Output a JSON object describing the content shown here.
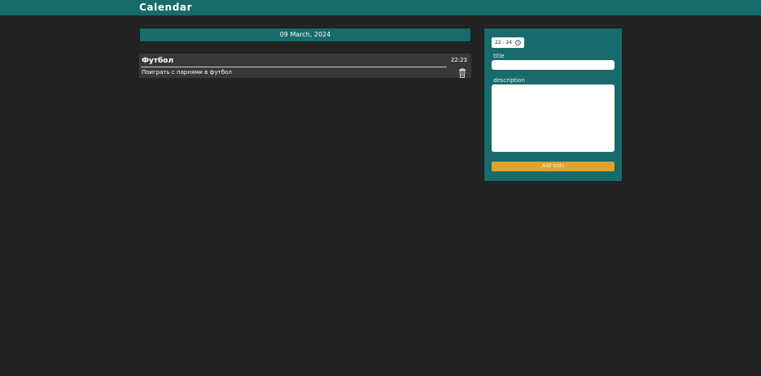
{
  "header": {
    "title": "Calendar"
  },
  "date_bar": {
    "label": "09 March, 2024"
  },
  "todos": [
    {
      "title": "Футбол",
      "time": "22:23",
      "description": "Поиграть с парнями в футбол",
      "delete_icon": "trash-icon"
    }
  ],
  "form": {
    "time_value": "22 : 24",
    "time_icon": "clock-icon",
    "title_label": "title",
    "title_value": "",
    "description_label": "description",
    "description_value": "",
    "submit_label": "Add todo"
  },
  "colors": {
    "background": "#232323",
    "accent_teal": "#176b6b",
    "card": "#383838",
    "button": "#e3a22a"
  }
}
